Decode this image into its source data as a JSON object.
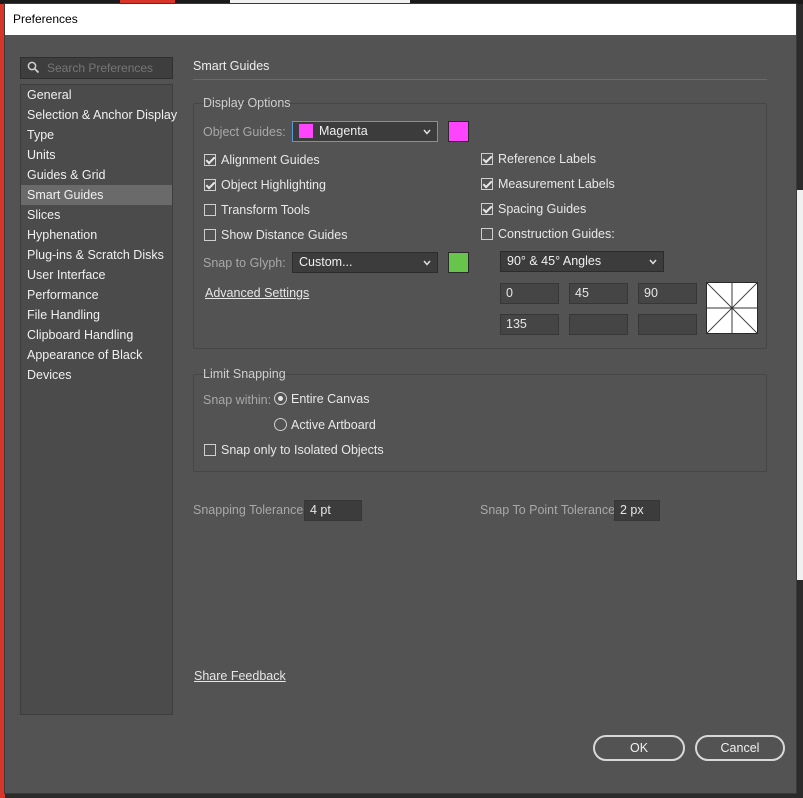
{
  "window": {
    "title": "Preferences"
  },
  "search": {
    "placeholder": "Search Preferences",
    "icon": "search-icon"
  },
  "sidebar": {
    "items": [
      {
        "label": "General"
      },
      {
        "label": "Selection & Anchor Display"
      },
      {
        "label": "Type"
      },
      {
        "label": "Units"
      },
      {
        "label": "Guides & Grid"
      },
      {
        "label": "Smart Guides",
        "selected": true
      },
      {
        "label": "Slices"
      },
      {
        "label": "Hyphenation"
      },
      {
        "label": "Plug-ins & Scratch Disks"
      },
      {
        "label": "User Interface"
      },
      {
        "label": "Performance"
      },
      {
        "label": "File Handling"
      },
      {
        "label": "Clipboard Handling"
      },
      {
        "label": "Appearance of Black"
      },
      {
        "label": "Devices"
      }
    ]
  },
  "main": {
    "section_title": "Smart Guides",
    "display_options": {
      "title": "Display Options",
      "object_guides_label": "Object Guides:",
      "object_guides_value": "Magenta",
      "object_guides_color": "#ff44ff",
      "alignment_guides": {
        "label": "Alignment Guides",
        "checked": true
      },
      "object_highlighting": {
        "label": "Object Highlighting",
        "checked": true
      },
      "transform_tools": {
        "label": "Transform Tools",
        "checked": false
      },
      "show_distance_guides": {
        "label": "Show Distance Guides",
        "checked": false
      },
      "reference_labels": {
        "label": "Reference Labels",
        "checked": true
      },
      "measurement_labels": {
        "label": "Measurement Labels",
        "checked": true
      },
      "spacing_guides": {
        "label": "Spacing Guides",
        "checked": true
      },
      "construction_guides": {
        "label": "Construction Guides:",
        "checked": false
      },
      "snap_to_glyph_label": "Snap to Glyph:",
      "snap_to_glyph_value": "Custom...",
      "snap_to_glyph_color": "#66c54a",
      "angles_value": "90° & 45° Angles",
      "angles": [
        "0",
        "45",
        "90",
        "135",
        "",
        ""
      ],
      "advanced_settings": "Advanced Settings"
    },
    "limit_snapping": {
      "title": "Limit Snapping",
      "snap_within_label": "Snap within:",
      "entire_canvas": {
        "label": "Entire Canvas",
        "selected": true
      },
      "active_artboard": {
        "label": "Active Artboard",
        "selected": false
      },
      "isolated_objects": {
        "label": "Snap only to Isolated Objects",
        "checked": false
      }
    },
    "snapping_tolerance": {
      "label": "Snapping Tolerance:",
      "value": "4 pt"
    },
    "snap_to_point_tolerance": {
      "label": "Snap To Point Tolerance:",
      "value": "2 px"
    },
    "share_feedback": "Share Feedback"
  },
  "footer": {
    "ok_label": "OK",
    "cancel_label": "Cancel"
  }
}
